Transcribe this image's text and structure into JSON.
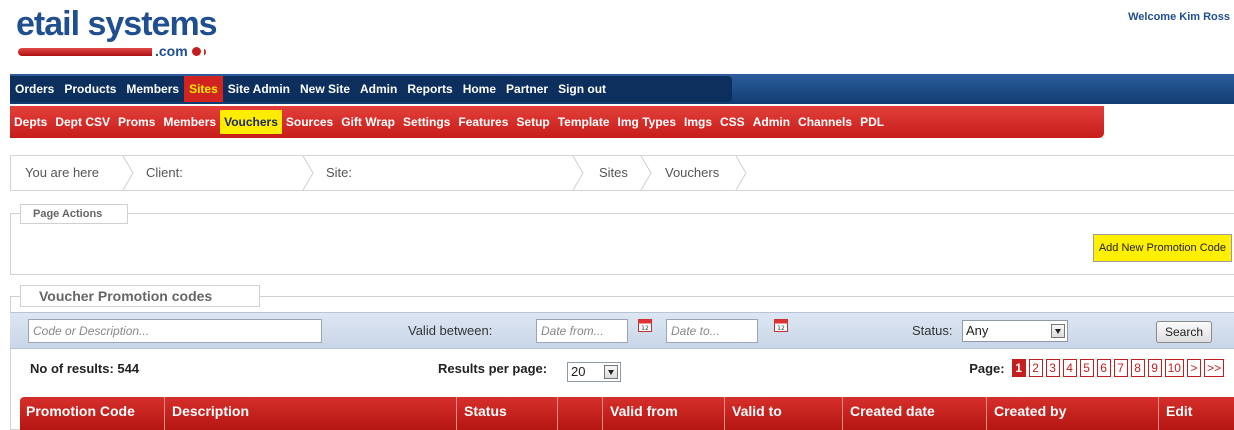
{
  "brand": {
    "logo_main": "etail systems",
    "logo_suffix": ".com"
  },
  "header": {
    "welcome": "Welcome Kim Ross"
  },
  "nav_primary": [
    {
      "label": "Orders",
      "active": false
    },
    {
      "label": "Products",
      "active": false
    },
    {
      "label": "Members",
      "active": false
    },
    {
      "label": "Sites",
      "active": true
    },
    {
      "label": "Site Admin",
      "active": false
    },
    {
      "label": "New Site",
      "active": false
    },
    {
      "label": "Admin",
      "active": false
    },
    {
      "label": "Reports",
      "active": false
    },
    {
      "label": "Home",
      "active": false
    },
    {
      "label": "Partner",
      "active": false
    },
    {
      "label": "Sign out",
      "active": false
    }
  ],
  "nav_secondary": [
    {
      "label": "Depts",
      "active": false
    },
    {
      "label": "Dept CSV",
      "active": false
    },
    {
      "label": "Proms",
      "active": false
    },
    {
      "label": "Members",
      "active": false
    },
    {
      "label": "Vouchers",
      "active": true
    },
    {
      "label": "Sources",
      "active": false
    },
    {
      "label": "Gift Wrap",
      "active": false
    },
    {
      "label": "Settings",
      "active": false
    },
    {
      "label": "Features",
      "active": false
    },
    {
      "label": "Setup",
      "active": false
    },
    {
      "label": "Template",
      "active": false
    },
    {
      "label": "Img Types",
      "active": false
    },
    {
      "label": "Imgs",
      "active": false
    },
    {
      "label": "CSS",
      "active": false
    },
    {
      "label": "Admin",
      "active": false
    },
    {
      "label": "Channels",
      "active": false
    },
    {
      "label": "PDL",
      "active": false
    }
  ],
  "breadcrumb": {
    "you_are_here": "You are here",
    "client_label": "Client:",
    "site_label": "Site:",
    "sites": "Sites",
    "vouchers": "Vouchers"
  },
  "page_actions": {
    "legend": "Page Actions",
    "add_button": "Add New Promotion Code"
  },
  "vouchers": {
    "legend": "Voucher Promotion codes",
    "search_placeholder": "Code or Description...",
    "valid_between_label": "Valid between:",
    "date_from_placeholder": "Date from...",
    "date_to_placeholder": "Date to...",
    "calendar_badge": "12",
    "status_label": "Status:",
    "status_value": "Any",
    "search_button": "Search",
    "results_text": "No of results: 544",
    "per_page_label": "Results per page:",
    "per_page_value": "20",
    "page_label": "Page:",
    "pages": [
      "1",
      "2",
      "3",
      "4",
      "5",
      "6",
      "7",
      "8",
      "9",
      "10",
      ">",
      ">>"
    ],
    "current_page": "1",
    "columns": [
      "Promotion Code",
      "Description",
      "Status",
      "",
      "Valid from",
      "Valid to",
      "Created date",
      "Created by",
      "Edit"
    ]
  },
  "colors": {
    "primary_nav": "#123c72",
    "secondary_nav": "#c71d19",
    "highlight": "#ffec00",
    "active_primary_bg": "#d1231f"
  }
}
